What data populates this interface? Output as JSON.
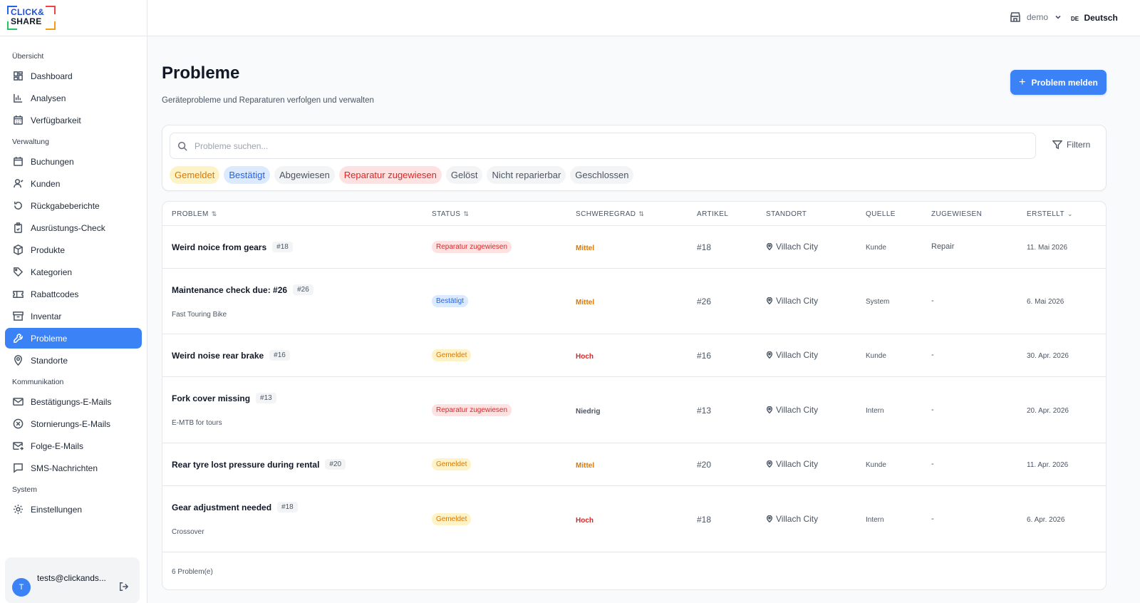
{
  "app": {
    "logo_line1": "CLICK&",
    "logo_line2": "SHARE"
  },
  "topbar": {
    "store_name": "demo",
    "lang_code": "DE",
    "lang_label": "Deutsch"
  },
  "sidebar": {
    "sections": [
      {
        "title": "Übersicht"
      },
      {
        "title": "Verwaltung"
      },
      {
        "title": "Kommunikation"
      },
      {
        "title": "System"
      }
    ],
    "items": [
      {
        "label": "Dashboard",
        "icon": "dashboard-icon"
      },
      {
        "label": "Analysen",
        "icon": "bar-chart-icon"
      },
      {
        "label": "Verfügbarkeit",
        "icon": "calendar-grid-icon"
      },
      {
        "label": "Buchungen",
        "icon": "calendar-icon"
      },
      {
        "label": "Kunden",
        "icon": "user-icon"
      },
      {
        "label": "Rückgabeberichte",
        "icon": "return-icon"
      },
      {
        "label": "Ausrüstungs-Check",
        "icon": "clipboard-check-icon"
      },
      {
        "label": "Produkte",
        "icon": "package-icon"
      },
      {
        "label": "Kategorien",
        "icon": "tag-icon"
      },
      {
        "label": "Rabattcodes",
        "icon": "ticket-icon"
      },
      {
        "label": "Inventar",
        "icon": "archive-icon"
      },
      {
        "label": "Probleme",
        "icon": "wrench-icon",
        "active": true
      },
      {
        "label": "Standorte",
        "icon": "map-pin-icon"
      },
      {
        "label": "Bestätigungs-E-Mails",
        "icon": "mail-icon"
      },
      {
        "label": "Stornierungs-E-Mails",
        "icon": "x-circle-icon"
      },
      {
        "label": "Folge-E-Mails",
        "icon": "mail-forward-icon"
      },
      {
        "label": "SMS-Nachrichten",
        "icon": "message-icon"
      },
      {
        "label": "Einstellungen",
        "icon": "gear-icon"
      }
    ],
    "user": {
      "initial": "T",
      "email": "tests@clickands..."
    }
  },
  "page": {
    "title": "Probleme",
    "subtitle": "Geräteprobleme und Reparaturen verfolgen und verwalten",
    "primary_button": "Problem melden"
  },
  "filters": {
    "search_placeholder": "Probleme suchen...",
    "filter_label": "Filtern",
    "chips": [
      {
        "label": "Gemeldet",
        "color": "#d97706"
      },
      {
        "label": "Bestätigt",
        "color": "#2563eb"
      },
      {
        "label": "Abgewiesen",
        "color": "#4b5563"
      },
      {
        "label": "Reparatur zugewiesen",
        "color": "#dc2626"
      },
      {
        "label": "Gelöst",
        "color": "#4b5563"
      },
      {
        "label": "Nicht reparierbar",
        "color": "#4b5563"
      },
      {
        "label": "Geschlossen",
        "color": "#4b5563"
      }
    ]
  },
  "table": {
    "columns": [
      {
        "label": "PROBLEM",
        "sortable": true
      },
      {
        "label": "STATUS",
        "sortable": true
      },
      {
        "label": "SCHWEREGRAD",
        "sortable": true
      },
      {
        "label": "ARTIKEL",
        "sortable": false
      },
      {
        "label": "STANDORT",
        "sortable": false
      },
      {
        "label": "QUELLE",
        "sortable": false
      },
      {
        "label": "ZUGEWIESEN",
        "sortable": false
      },
      {
        "label": "ERSTELLT",
        "sortable": false,
        "dropdown": true
      }
    ],
    "rows": [
      {
        "title": "Weird noice from gears",
        "id": "#18",
        "sub": "",
        "status": "Reparatur zugewiesen",
        "status_kind": "red",
        "severity": "Mittel",
        "sev_kind": "mittel",
        "article": "#18",
        "location": "Villach City",
        "source": "Kunde",
        "assigned": "Repair",
        "created": "11. Mai 2026"
      },
      {
        "title": "Maintenance check due: #26",
        "id": "#26",
        "sub": "Fast Touring Bike",
        "status": "Bestätigt",
        "status_kind": "blue",
        "severity": "Mittel",
        "sev_kind": "mittel",
        "article": "#26",
        "location": "Villach City",
        "source": "System",
        "assigned": "-",
        "created": "6. Mai 2026"
      },
      {
        "title": "Weird noise rear brake",
        "id": "#16",
        "sub": "",
        "status": "Gemeldet",
        "status_kind": "yellow",
        "severity": "Hoch",
        "sev_kind": "hoch",
        "article": "#16",
        "location": "Villach City",
        "source": "Kunde",
        "assigned": "-",
        "created": "30. Apr. 2026"
      },
      {
        "title": "Fork cover missing",
        "id": "#13",
        "sub": "E-MTB for tours",
        "status": "Reparatur zugewiesen",
        "status_kind": "red",
        "severity": "Niedrig",
        "sev_kind": "niedrig",
        "article": "#13",
        "location": "Villach City",
        "source": "Intern",
        "assigned": "-",
        "created": "20. Apr. 2026"
      },
      {
        "title": "Rear tyre lost pressure during rental",
        "id": "#20",
        "sub": "",
        "status": "Gemeldet",
        "status_kind": "yellow",
        "severity": "Mittel",
        "sev_kind": "mittel",
        "article": "#20",
        "location": "Villach City",
        "source": "Kunde",
        "assigned": "-",
        "created": "11. Apr. 2026"
      },
      {
        "title": "Gear adjustment needed",
        "id": "#18",
        "sub": "Crossover",
        "status": "Gemeldet",
        "status_kind": "yellow",
        "severity": "Hoch",
        "sev_kind": "hoch",
        "article": "#18",
        "location": "Villach City",
        "source": "Intern",
        "assigned": "-",
        "created": "6. Apr. 2026"
      }
    ],
    "footer": "6 Problem(e)"
  },
  "colors": {
    "accent": "#3b82f6"
  }
}
